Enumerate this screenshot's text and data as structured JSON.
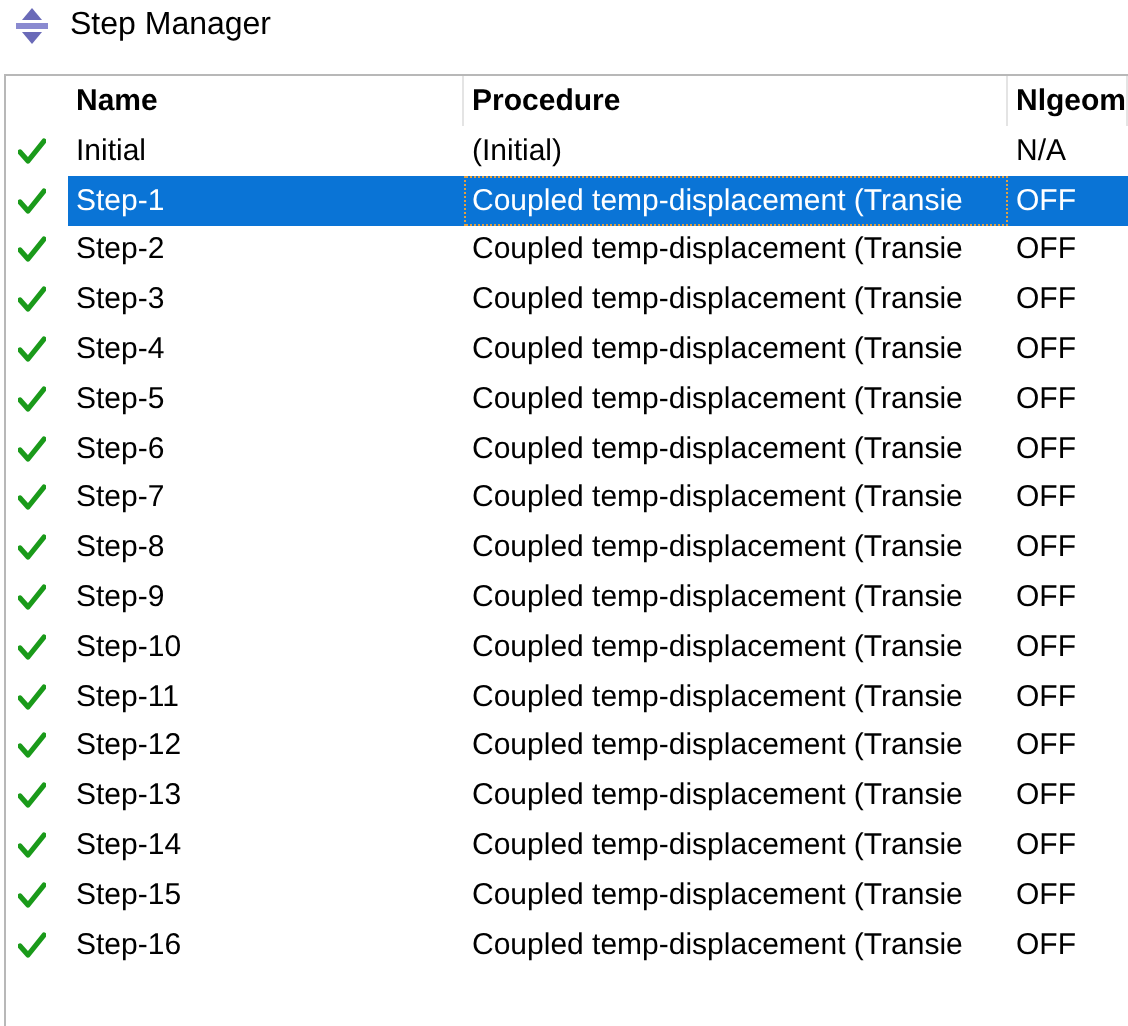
{
  "window": {
    "title": "Step Manager"
  },
  "table": {
    "columns": [
      "Name",
      "Procedure",
      "Nlgeom"
    ],
    "rows": [
      {
        "name": "Initial",
        "procedure": "(Initial)",
        "nlgeom": "N/A",
        "checked": true,
        "selected": false
      },
      {
        "name": "Step-1",
        "procedure": "Coupled temp-displacement (Transie",
        "nlgeom": "OFF",
        "checked": true,
        "selected": true
      },
      {
        "name": "Step-2",
        "procedure": "Coupled temp-displacement (Transie",
        "nlgeom": "OFF",
        "checked": true,
        "selected": false
      },
      {
        "name": "Step-3",
        "procedure": "Coupled temp-displacement (Transie",
        "nlgeom": "OFF",
        "checked": true,
        "selected": false
      },
      {
        "name": "Step-4",
        "procedure": "Coupled temp-displacement (Transie",
        "nlgeom": "OFF",
        "checked": true,
        "selected": false
      },
      {
        "name": "Step-5",
        "procedure": "Coupled temp-displacement (Transie",
        "nlgeom": "OFF",
        "checked": true,
        "selected": false
      },
      {
        "name": "Step-6",
        "procedure": "Coupled temp-displacement (Transie",
        "nlgeom": "OFF",
        "checked": true,
        "selected": false
      },
      {
        "name": "Step-7",
        "procedure": "Coupled temp-displacement (Transie",
        "nlgeom": "OFF",
        "checked": true,
        "selected": false
      },
      {
        "name": "Step-8",
        "procedure": "Coupled temp-displacement (Transie",
        "nlgeom": "OFF",
        "checked": true,
        "selected": false
      },
      {
        "name": "Step-9",
        "procedure": "Coupled temp-displacement (Transie",
        "nlgeom": "OFF",
        "checked": true,
        "selected": false
      },
      {
        "name": "Step-10",
        "procedure": "Coupled temp-displacement (Transie",
        "nlgeom": "OFF",
        "checked": true,
        "selected": false
      },
      {
        "name": "Step-11",
        "procedure": "Coupled temp-displacement (Transie",
        "nlgeom": "OFF",
        "checked": true,
        "selected": false
      },
      {
        "name": "Step-12",
        "procedure": "Coupled temp-displacement (Transie",
        "nlgeom": "OFF",
        "checked": true,
        "selected": false
      },
      {
        "name": "Step-13",
        "procedure": "Coupled temp-displacement (Transie",
        "nlgeom": "OFF",
        "checked": true,
        "selected": false
      },
      {
        "name": "Step-14",
        "procedure": "Coupled temp-displacement (Transie",
        "nlgeom": "OFF",
        "checked": true,
        "selected": false
      },
      {
        "name": "Step-15",
        "procedure": "Coupled temp-displacement (Transie",
        "nlgeom": "OFF",
        "checked": true,
        "selected": false
      },
      {
        "name": "Step-16",
        "procedure": "Coupled temp-displacement (Transie",
        "nlgeom": "OFF",
        "checked": true,
        "selected": false
      }
    ]
  }
}
